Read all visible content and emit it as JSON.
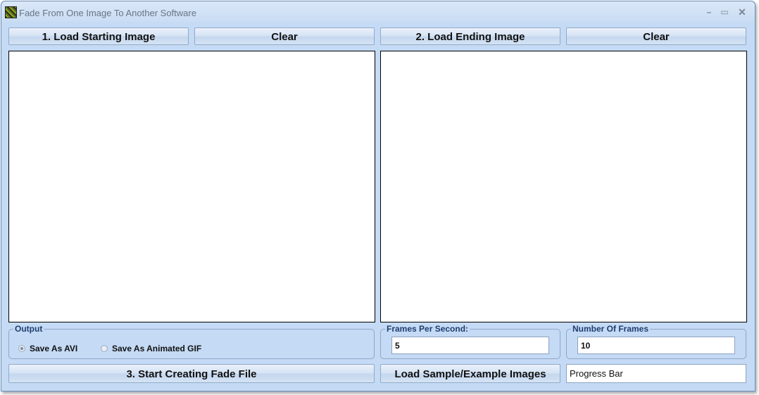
{
  "window": {
    "title": "Fade From One Image To Another Software",
    "controls": {
      "minimize": "–",
      "maximize": "▭",
      "close": "✕"
    }
  },
  "toolbar": {
    "load_start_label": "1. Load Starting Image",
    "clear_start_label": "Clear",
    "load_end_label": "2. Load Ending Image",
    "clear_end_label": "Clear"
  },
  "output": {
    "group_label": "Output",
    "options": [
      {
        "label": "Save As AVI",
        "checked": true
      },
      {
        "label": "Save As Animated GIF",
        "checked": false
      }
    ]
  },
  "fps": {
    "group_label": "Frames Per Second:",
    "value": "5"
  },
  "frames": {
    "group_label": "Number Of Frames",
    "value": "10"
  },
  "actions": {
    "start_label": "3. Start Creating Fade File",
    "load_sample_label": "Load Sample/Example Images"
  },
  "progress": {
    "label": "Progress Bar",
    "percent": 0
  }
}
